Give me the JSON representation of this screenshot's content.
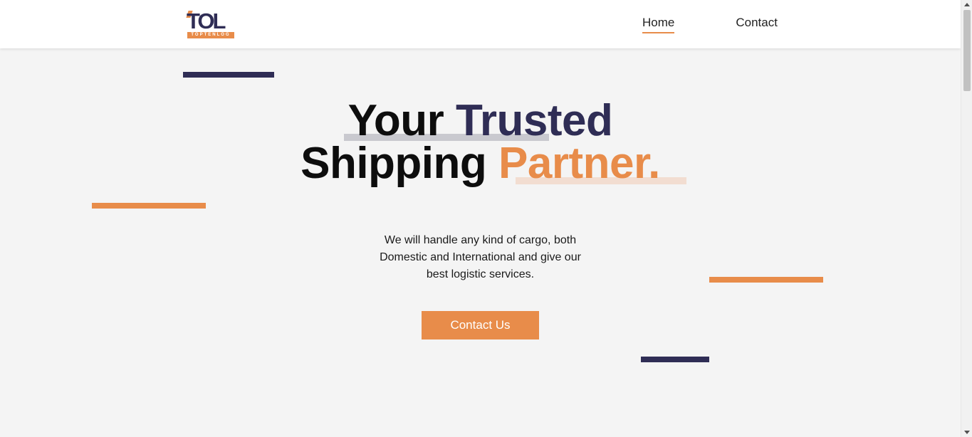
{
  "brand": {
    "logo_mark": "TOL",
    "logo_subtext": "TOPTENLOG",
    "accent_color": "#e88c4a",
    "navy_color": "#2f2d55"
  },
  "nav": {
    "items": [
      {
        "label": "Home",
        "active": true
      },
      {
        "label": "Contact",
        "active": false
      }
    ]
  },
  "hero": {
    "title_line1_word1": "Your",
    "title_line1_word2": "Trusted",
    "title_line2_word1": "Shipping",
    "title_line2_word2": "Partner.",
    "subtitle_lines": [
      "We will handle any kind of cargo, both",
      "Domestic and International and give our",
      "best logistic services."
    ],
    "cta_label": "Contact Us"
  }
}
